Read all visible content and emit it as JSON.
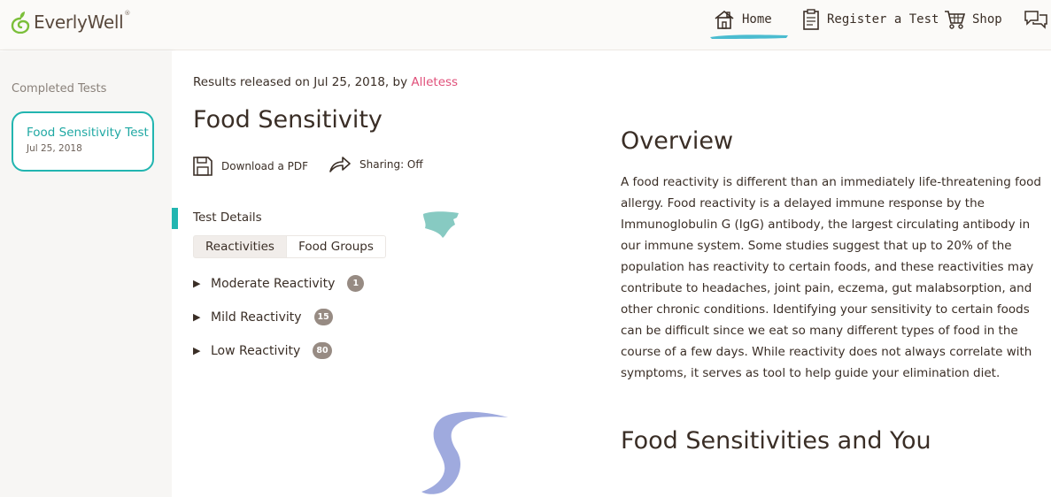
{
  "brand": {
    "name": "EverlyWell",
    "reg": "®",
    "accent": "#22b5b0",
    "leaf_color": "#7bbf3a"
  },
  "nav": {
    "home": "Home",
    "register": "Register a Test",
    "shop": "Shop"
  },
  "sidebar": {
    "heading": "Completed Tests",
    "tests": [
      {
        "title": "Food Sensitivity Test",
        "date": "Jul 25, 2018"
      }
    ]
  },
  "main": {
    "released_prefix": "Results released on Jul 25, 2018, by",
    "released_author": "Alletess",
    "title": "Food Sensitivity",
    "actions": {
      "pdf": "Download a PDF",
      "sharing": "Sharing: Off"
    },
    "details_label": "Test Details",
    "tabs": [
      "Reactivities",
      "Food Groups"
    ],
    "reactivities": [
      {
        "label": "Moderate Reactivity",
        "count": "1"
      },
      {
        "label": "Mild Reactivity",
        "count": "15"
      },
      {
        "label": "Low Reactivity",
        "count": "80"
      }
    ]
  },
  "overview": {
    "title": "Overview",
    "body": "A food reactivity is different than an immediately life-threatening food allergy. Food reactivity is a delayed immune response by the Immunoglobulin G (IgG) antibody, the largest circulating antibody in our immune system. Some studies suggest that up to 20% of the population has reactivity to certain foods, and these reactivities may contribute to headaches, joint pain, eczema, gut malabsorption, and other chronic conditions. Identifying your sensitivity to certain foods can be difficult since we eat so many different types of food in the course of a few days. While reactivity does not always correlate with symptoms, it serves as tool to help guide your elimination diet."
  },
  "section2": {
    "title": "Food Sensitivities and You"
  }
}
